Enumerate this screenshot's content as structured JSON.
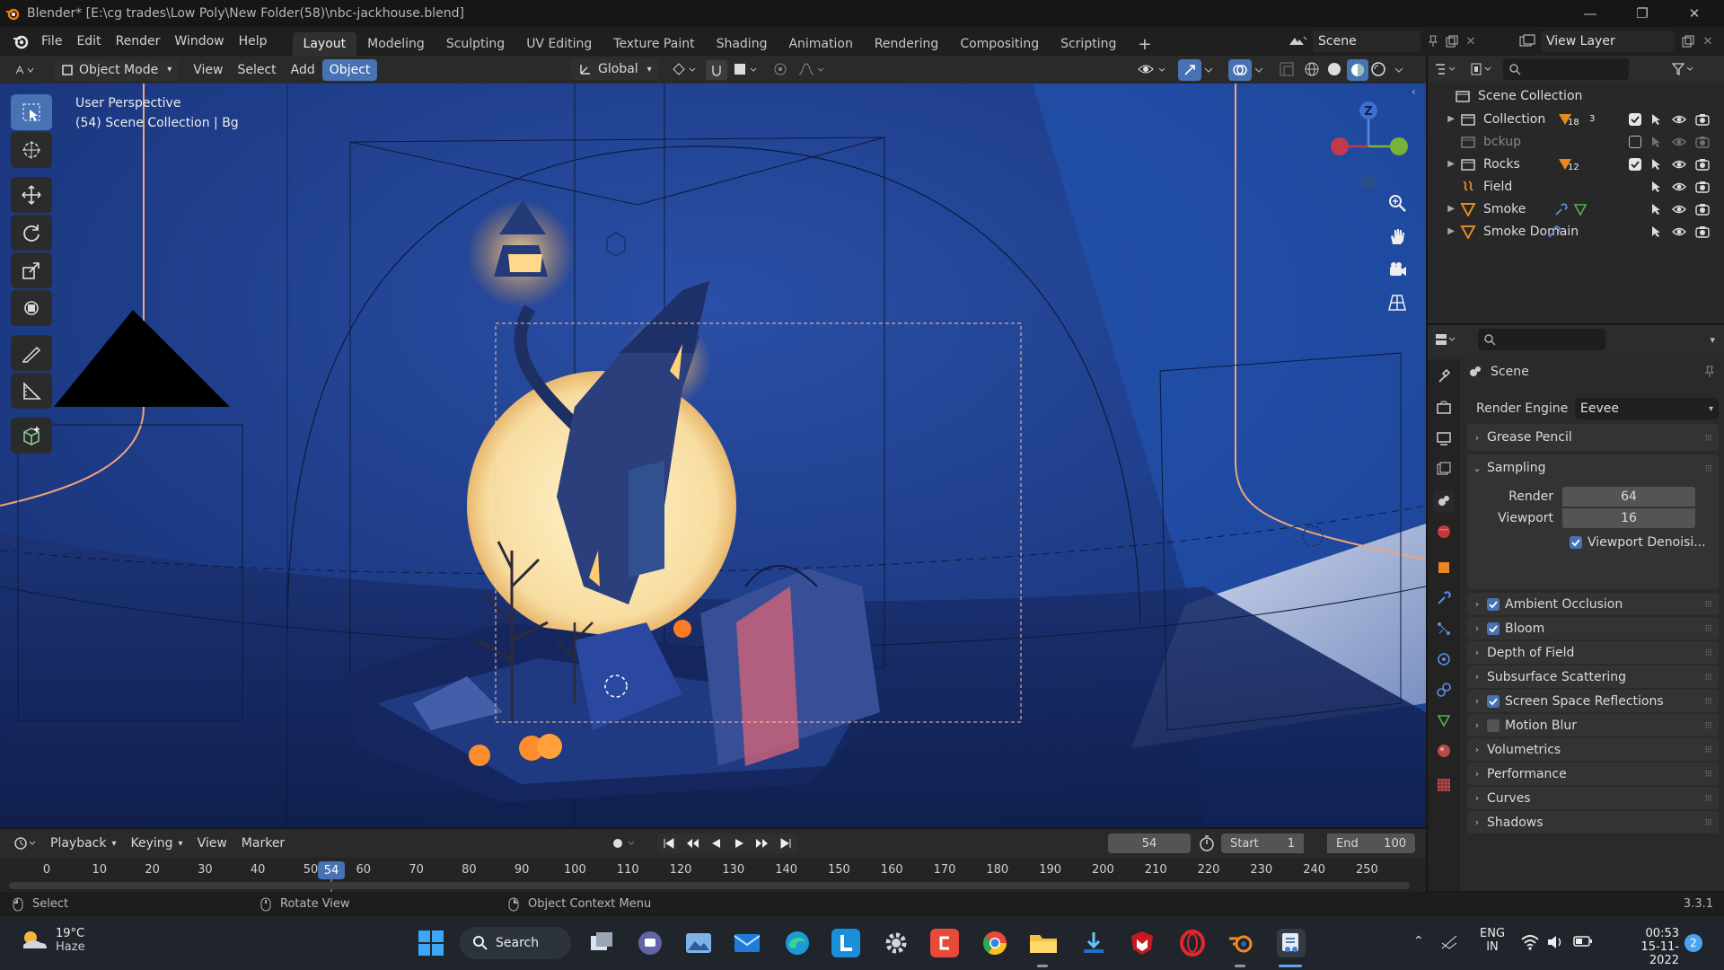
{
  "window": {
    "title": "Blender* [E:\\cg trades\\Low Poly\\New Folder(58)\\nbc-jackhouse.blend]"
  },
  "menubar": {
    "menus": [
      "File",
      "Edit",
      "Render",
      "Window",
      "Help"
    ],
    "workspaces": [
      "Layout",
      "Modeling",
      "Sculpting",
      "UV Editing",
      "Texture Paint",
      "Shading",
      "Animation",
      "Rendering",
      "Compositing",
      "Scripting"
    ],
    "active_workspace": "Layout",
    "add_workspace": "+",
    "scene_name": "Scene",
    "view_layer_name": "View Layer"
  },
  "viewport_header": {
    "mode": "Object Mode",
    "menus": [
      "View",
      "Select",
      "Add",
      "Object"
    ],
    "active_menu": "Object",
    "transform_orientation": "Global"
  },
  "viewport": {
    "info_line1": "User Perspective",
    "info_line2": "(54) Scene Collection | Bg",
    "gizmo_axis_label": "Z",
    "colors": {
      "sky": "#1a3a85",
      "moon": "#f7dca0",
      "glow": "#ff9a2a",
      "ground": "#14245a",
      "floor_light": "#b9c7e6"
    }
  },
  "toolbar": {
    "tools": [
      "select-box",
      "cursor",
      "move",
      "rotate",
      "scale",
      "transform",
      "annotate",
      "measure",
      "add-cube"
    ],
    "active_tool": "select-box"
  },
  "outliner": {
    "root": "Scene Collection",
    "items": [
      {
        "name": "Collection",
        "badge1": "18",
        "badge2": "3",
        "checked": true,
        "expandable": true,
        "dimmed": false
      },
      {
        "name": "bckup",
        "badge1": "",
        "badge2": "",
        "checked": false,
        "expandable": false,
        "dimmed": true
      },
      {
        "name": "Rocks",
        "badge1": "12",
        "badge2": "",
        "checked": true,
        "expandable": true,
        "dimmed": false
      },
      {
        "name": "Field",
        "badge1": "",
        "badge2": "",
        "checked": null,
        "expandable": false,
        "dimmed": false
      },
      {
        "name": "Smoke",
        "badge1": "",
        "badge2": "",
        "checked": null,
        "expandable": true,
        "dimmed": false
      },
      {
        "name": "Smoke Domain",
        "badge1": "",
        "badge2": "",
        "checked": null,
        "expandable": true,
        "dimmed": false
      }
    ]
  },
  "properties": {
    "context": "Scene",
    "render_engine_label": "Render Engine",
    "render_engine": "Eevee",
    "sampling": {
      "title": "Sampling",
      "render_label": "Render",
      "render_value": "64",
      "viewport_label": "Viewport",
      "viewport_value": "16",
      "denoise_label": "Viewport Denoisi...",
      "denoise_checked": true
    },
    "panels": [
      {
        "name": "Grease Pencil",
        "checkbox": null
      },
      {
        "name": "Ambient Occlusion",
        "checkbox": true
      },
      {
        "name": "Bloom",
        "checkbox": true
      },
      {
        "name": "Depth of Field",
        "checkbox": null
      },
      {
        "name": "Subsurface Scattering",
        "checkbox": null
      },
      {
        "name": "Screen Space Reflections",
        "checkbox": true
      },
      {
        "name": "Motion Blur",
        "checkbox": false
      },
      {
        "name": "Volumetrics",
        "checkbox": null
      },
      {
        "name": "Performance",
        "checkbox": null
      },
      {
        "name": "Curves",
        "checkbox": null
      },
      {
        "name": "Shadows",
        "checkbox": null
      }
    ]
  },
  "timeline": {
    "menus": [
      "Playback",
      "Keying",
      "View",
      "Marker"
    ],
    "current_frame": "54",
    "start_label": "Start",
    "start": "1",
    "end_label": "End",
    "end": "100",
    "ticks": [
      "0",
      "10",
      "20",
      "30",
      "40",
      "50",
      "60",
      "70",
      "80",
      "90",
      "100",
      "110",
      "120",
      "130",
      "140",
      "150",
      "160",
      "170",
      "180",
      "190",
      "200",
      "210",
      "220",
      "230",
      "240",
      "250"
    ]
  },
  "statusbar": {
    "hint_select": "Select",
    "hint_rotate": "Rotate View",
    "hint_context": "Object Context Menu",
    "version": "3.3.1"
  },
  "taskbar": {
    "weather_temp": "19°C",
    "weather_desc": "Haze",
    "search_label": "Search",
    "lang1": "ENG",
    "lang2": "IN",
    "time": "00:53",
    "date": "15-11-2022",
    "notifications": "2"
  }
}
